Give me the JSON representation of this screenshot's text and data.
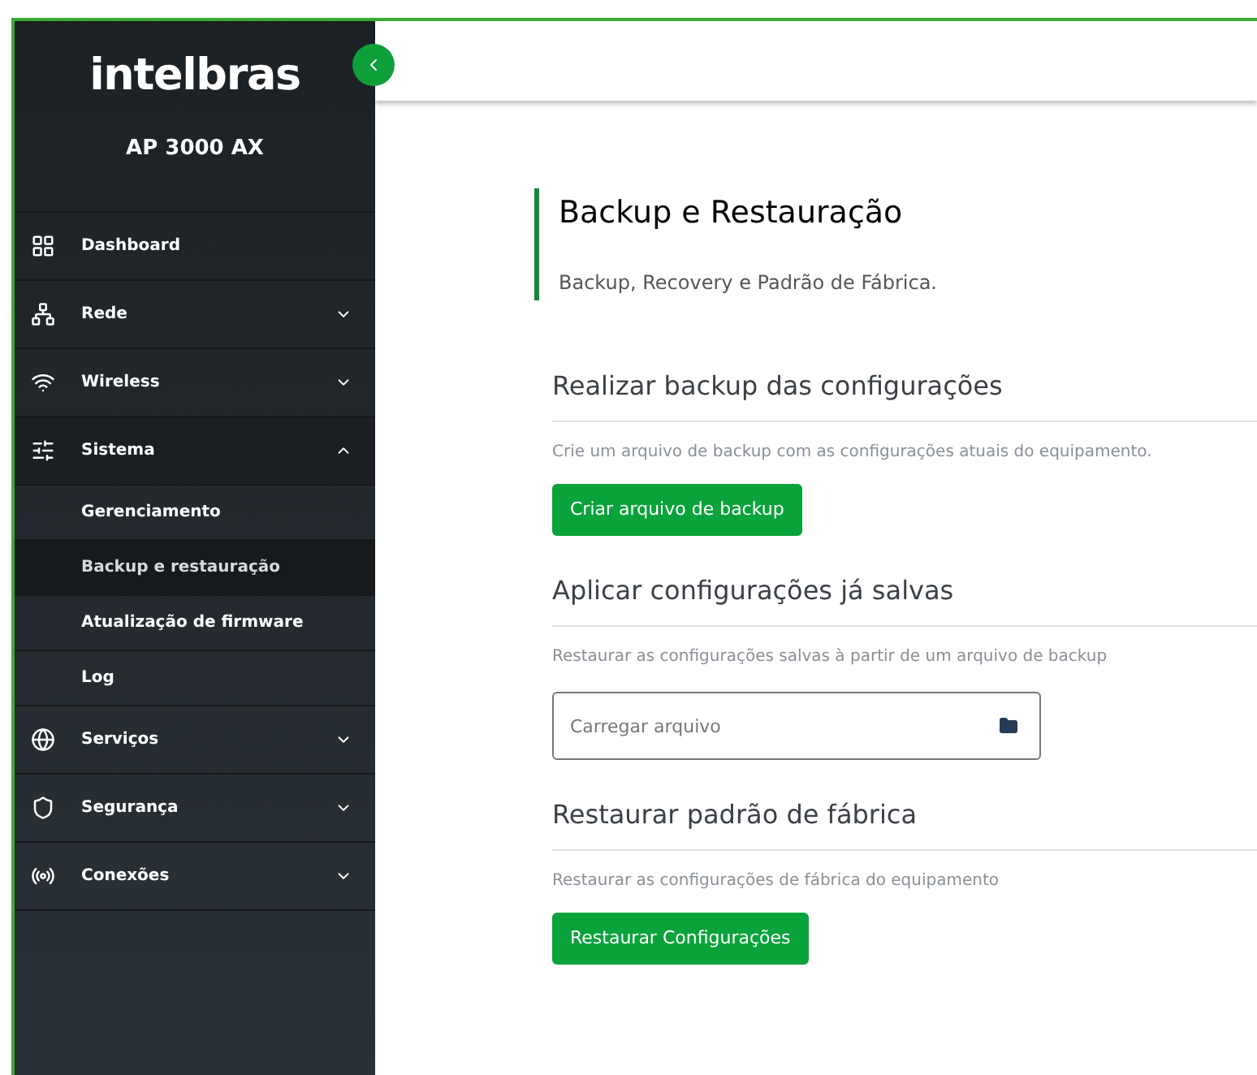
{
  "sidebar": {
    "logo": "intelbras",
    "model": "AP 3000 AX",
    "items": [
      {
        "label": "Dashboard",
        "kind": "dashboard",
        "expandable": false
      },
      {
        "label": "Rede",
        "kind": "network",
        "expandable": true,
        "expanded": false
      },
      {
        "label": "Wireless",
        "kind": "wifi",
        "expandable": true,
        "expanded": false
      },
      {
        "label": "Sistema",
        "kind": "system",
        "expandable": true,
        "expanded": true,
        "children": [
          {
            "label": "Gerenciamento",
            "selected": false
          },
          {
            "label": "Backup e restauração",
            "selected": true
          },
          {
            "label": "Atualização de firmware",
            "selected": false
          },
          {
            "label": "Log",
            "selected": false
          }
        ]
      },
      {
        "label": "Serviços",
        "kind": "services",
        "expandable": true,
        "expanded": false
      },
      {
        "label": "Segurança",
        "kind": "security",
        "expandable": true,
        "expanded": false
      },
      {
        "label": "Conexões",
        "kind": "connections",
        "expandable": true,
        "expanded": false
      }
    ]
  },
  "page": {
    "title": "Backup e Restauração",
    "subtitle": "Backup, Recovery e Padrão de Fábrica.",
    "sections": [
      {
        "heading": "Realizar backup das configurações",
        "description": "Crie um arquivo de backup com as configurações atuais do equipamento.",
        "kind": "button",
        "label": "Criar arquivo de backup"
      },
      {
        "heading": "Aplicar configurações já salvas",
        "description": "Restaurar as configurações salvas à partir de um arquivo de backup",
        "kind": "file",
        "placeholder": "Carregar arquivo"
      },
      {
        "heading": "Restaurar padrão de fábrica",
        "description": "Restaurar as configurações de fábrica do equipamento",
        "kind": "button",
        "label": "Restaurar Configurações"
      }
    ]
  }
}
